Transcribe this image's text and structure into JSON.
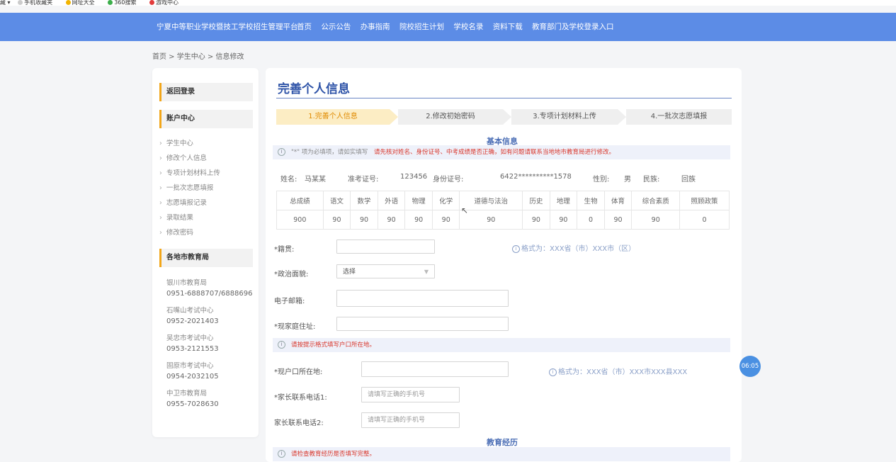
{
  "bookmarks": [
    "藏 ▾",
    "手机收藏夹",
    "网址大全",
    "360搜索",
    "游戏中心"
  ],
  "nav": {
    "site_title": "宁夏中等职业学校暨技工学校招生管理平台",
    "links": [
      "首页",
      "公示公告",
      "办事指南",
      "院校招生计划",
      "学校名录",
      "资料下载",
      "教育部门及学校登录入口"
    ]
  },
  "breadcrumb": "首页 > 学生中心 > 信息修改",
  "sidebar": {
    "back_login": "返回登录",
    "account_center": "账户中心",
    "links": [
      "学生中心",
      "修改个人信息",
      "专项计划材料上传",
      "一批次志愿填报",
      "志愿填报记录",
      "录取结果",
      "修改密码"
    ],
    "edu_title": "各地市教育局",
    "edu": [
      {
        "name": "银川市教育局",
        "phone": "0951-6888707/6888696"
      },
      {
        "name": "石嘴山考试中心",
        "phone": "0952-2021403"
      },
      {
        "name": "吴忠市考试中心",
        "phone": "0953-2121553"
      },
      {
        "name": "固原市考试中心",
        "phone": "0954-2032105"
      },
      {
        "name": "中卫市教育局",
        "phone": "0955-7028630"
      }
    ]
  },
  "main": {
    "title": "完善个人信息",
    "steps": [
      "1.完善个人信息",
      "2.修改初始密码",
      "3.专项计划材料上传",
      "4.一批次志愿填报"
    ],
    "basic_title": "基本信息",
    "notice1_gray": "\"*\" 项为必填项，请如实填写",
    "notice1_red": "请先核对姓名、身份证号、中考成绩是否正确，如有问题请联系当地地市教育局进行修改。",
    "info": {
      "name_label": "姓名:",
      "name": "马某某",
      "exam_label": "准考证号:",
      "exam": "123456",
      "id_label": "身份证号:",
      "id": "6422**********1578",
      "gender_label": "性别:",
      "gender": "男",
      "ethnic_label": "民族:",
      "ethnic": "回族"
    },
    "score_headers": [
      "总成绩",
      "语文",
      "数学",
      "外语",
      "物理",
      "化学",
      "道德与法治",
      "历史",
      "地理",
      "生物",
      "体育",
      "综合素质",
      "照顾政策"
    ],
    "score_values": [
      "900",
      "90",
      "90",
      "90",
      "90",
      "90",
      "90",
      "90",
      "90",
      "0",
      "90",
      "90",
      "0"
    ],
    "form": {
      "jiguan_label": "*籍贯:",
      "jiguan_hint": "格式为：XXX省（市）XXX市（区）",
      "politics_label": "*政治面貌:",
      "politics_value": "选择",
      "email_label": "电子邮箱:",
      "address_label": "*现家庭住址:",
      "notice2": "请按提示格式填写户口所在地。",
      "hukou_label": "*现户口所在地:",
      "hukou_hint": "格式为：XXX省（市）XXX市XXX县XXX",
      "phone1_label": "*家长联系电话1:",
      "phone1_placeholder": "请填写正确的手机号",
      "phone2_label": "家长联系电话2:",
      "phone2_placeholder": "请填写正确的手机号"
    },
    "edu_title": "教育经历",
    "notice3": "请检查教育经历是否填写完整。"
  },
  "timer": "06:05",
  "colors": {
    "nav_blue": "#5c8ce6",
    "accent_orange": "#f2a619",
    "title_blue": "#2f54a8",
    "warn_red": "#d9372c"
  }
}
